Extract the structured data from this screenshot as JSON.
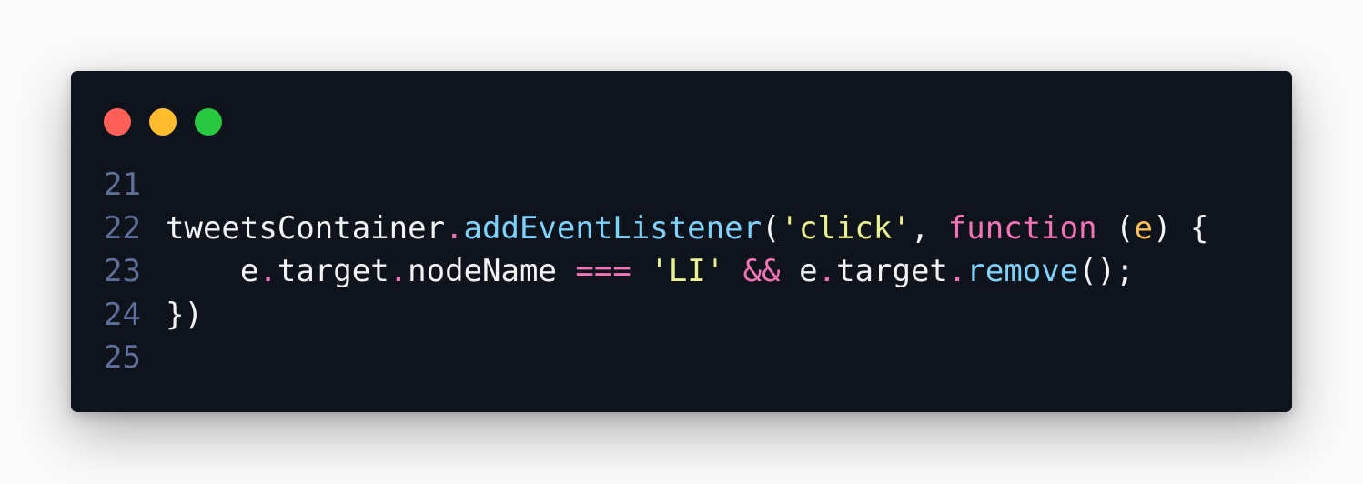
{
  "window": {
    "controls": [
      {
        "name": "close",
        "color": "#ff5f57"
      },
      {
        "name": "minimize",
        "color": "#febc2e"
      },
      {
        "name": "maximize",
        "color": "#28c840"
      }
    ]
  },
  "colors": {
    "background": "#0f131b",
    "line_number": "#5e6f9a",
    "plain": "#f3f4f6",
    "method": "#7dd3fc",
    "string": "#ecf28f",
    "keyword": "#f472b6",
    "param": "#fbbf57"
  },
  "lines": [
    {
      "number": "21",
      "tokens": []
    },
    {
      "number": "22",
      "tokens": [
        {
          "text": "tweetsContainer",
          "kind": "plain"
        },
        {
          "text": ".",
          "kind": "member"
        },
        {
          "text": "addEventListener",
          "kind": "method"
        },
        {
          "text": "(",
          "kind": "plain"
        },
        {
          "text": "'click'",
          "kind": "string"
        },
        {
          "text": ", ",
          "kind": "plain"
        },
        {
          "text": "function",
          "kind": "keyword"
        },
        {
          "text": " (",
          "kind": "plain"
        },
        {
          "text": "e",
          "kind": "param"
        },
        {
          "text": ") {",
          "kind": "plain"
        }
      ]
    },
    {
      "number": "23",
      "tokens": [
        {
          "text": "    e",
          "kind": "plain"
        },
        {
          "text": ".",
          "kind": "member"
        },
        {
          "text": "target",
          "kind": "plain"
        },
        {
          "text": ".",
          "kind": "member"
        },
        {
          "text": "nodeName ",
          "kind": "plain"
        },
        {
          "text": "===",
          "kind": "operator"
        },
        {
          "text": " ",
          "kind": "plain"
        },
        {
          "text": "'LI'",
          "kind": "string"
        },
        {
          "text": " ",
          "kind": "plain"
        },
        {
          "text": "&&",
          "kind": "operator"
        },
        {
          "text": " e",
          "kind": "plain"
        },
        {
          "text": ".",
          "kind": "member"
        },
        {
          "text": "target",
          "kind": "plain"
        },
        {
          "text": ".",
          "kind": "member"
        },
        {
          "text": "remove",
          "kind": "method"
        },
        {
          "text": "();",
          "kind": "plain"
        }
      ]
    },
    {
      "number": "24",
      "tokens": [
        {
          "text": "})",
          "kind": "plain"
        }
      ]
    },
    {
      "number": "25",
      "tokens": []
    }
  ]
}
